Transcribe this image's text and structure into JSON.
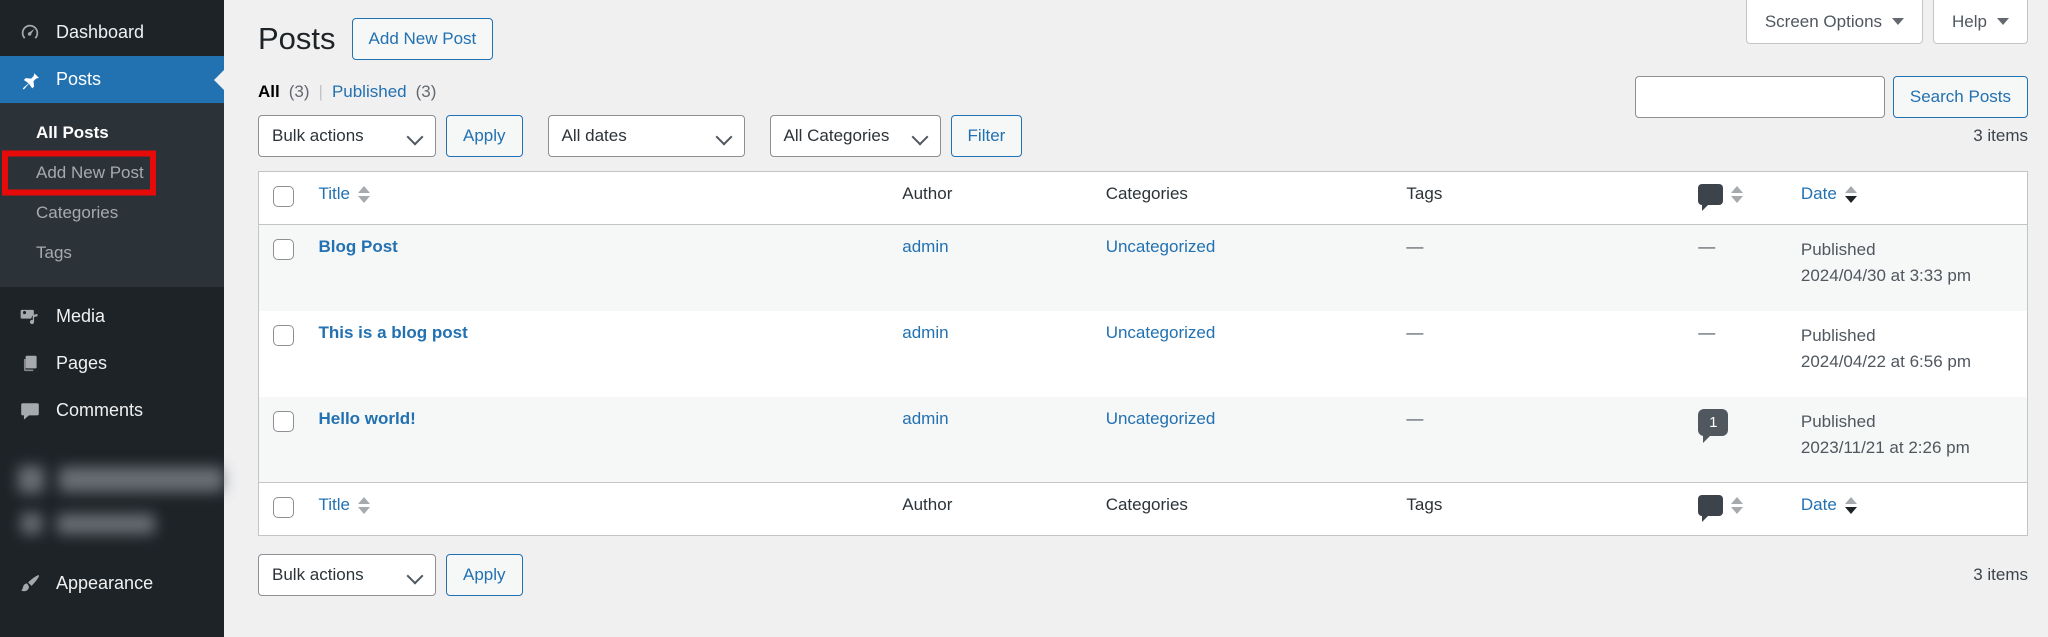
{
  "colors": {
    "accent_blue": "#2271b1",
    "sidebar_bg": "#1d2327",
    "sidebar_submenu_bg": "#2c3338",
    "page_bg": "#f0f0f1",
    "table_border": "#c3c4c7",
    "row_stripe": "#f6f7f7",
    "annotation_red": "#e60b09",
    "comment_bubble": "#50575e"
  },
  "topbar": {
    "screen_options": "Screen Options",
    "help": "Help"
  },
  "sidebar": {
    "dashboard": "Dashboard",
    "posts": "Posts",
    "all_posts": "All Posts",
    "add_new_post": "Add New Post",
    "categories": "Categories",
    "tags": "Tags",
    "media": "Media",
    "pages": "Pages",
    "comments": "Comments",
    "appearance": "Appearance"
  },
  "page_header": {
    "title": "Posts",
    "add_new_button": "Add New Post"
  },
  "view_filters": {
    "all": "All",
    "all_count": "(3)",
    "divider": "|",
    "published": "Published",
    "published_count": "(3)"
  },
  "search": {
    "input_value": "",
    "button": "Search Posts"
  },
  "tablenav_top": {
    "bulk_actions": "Bulk actions",
    "apply": "Apply",
    "all_dates": "All dates",
    "all_categories": "All Categories",
    "filter": "Filter",
    "item_count": "3 items"
  },
  "tablenav_bottom": {
    "bulk_actions": "Bulk actions",
    "apply": "Apply",
    "item_count": "3 items"
  },
  "table": {
    "headers": {
      "title": "Title",
      "author": "Author",
      "categories": "Categories",
      "tags": "Tags",
      "date": "Date"
    },
    "rows": [
      {
        "title": "Blog Post",
        "author": "admin",
        "categories": "Uncategorized",
        "tags": "—",
        "comments": "—",
        "status": "Published",
        "date": "2024/04/30 at 3:33 pm"
      },
      {
        "title": "This is a blog post",
        "author": "admin",
        "categories": "Uncategorized",
        "tags": "—",
        "comments": "—",
        "status": "Published",
        "date": "2024/04/22 at 6:56 pm"
      },
      {
        "title": "Hello world!",
        "author": "admin",
        "categories": "Uncategorized",
        "tags": "—",
        "comments": "1",
        "status": "Published",
        "date": "2023/11/21 at 2:26 pm"
      }
    ]
  }
}
